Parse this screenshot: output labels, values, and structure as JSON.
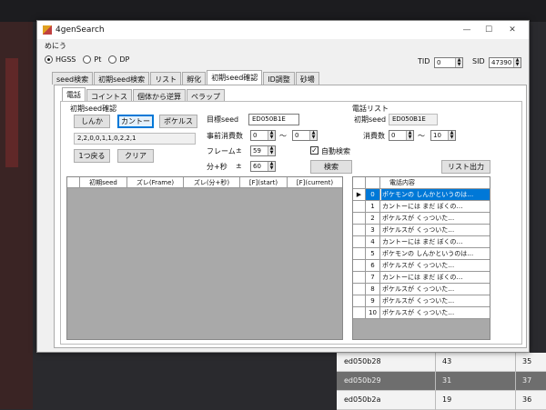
{
  "window": {
    "title": "4genSearch",
    "minimize": "—",
    "maximize": "☐",
    "close": "✕"
  },
  "menu": {
    "item": "めにう"
  },
  "versions": [
    {
      "label": "HGSS",
      "selected": true
    },
    {
      "label": "Pt",
      "selected": false
    },
    {
      "label": "DP",
      "selected": false
    }
  ],
  "tid": {
    "label": "TID",
    "value": "0"
  },
  "sid": {
    "label": "SID",
    "value": "47390"
  },
  "tabs": [
    "seed検索",
    "初期seed検索",
    "リスト",
    "孵化",
    "初期seed確認",
    "ID調整",
    "砂場"
  ],
  "subtabs": [
    "電話",
    "コイントス",
    "個体から逆算",
    "ペラップ"
  ],
  "left_group": {
    "title": "初期seed確認",
    "buttons": [
      "しんか",
      "カントー",
      "ポケルス"
    ],
    "sequence": "2,2,0,0,1,1,0,2,2,1",
    "back": "1つ戻る",
    "clear": "クリア"
  },
  "middle": {
    "target_seed_label": "目標seed",
    "target_seed_value": "ED050B1E",
    "pre_consume_label": "事前消費数",
    "pre_from": "0",
    "tilde": "〜",
    "pre_to": "0",
    "frame_label": "フレーム",
    "pm": "±",
    "frame_value": "59",
    "minsec_label": "分+秒",
    "minsec_value": "60",
    "auto_search": "自動検索",
    "search_button": "検索"
  },
  "left_grid": {
    "columns": [
      "初期seed",
      "ズレ(Frame)",
      "ズレ(分+秒)",
      "[F](start)",
      "[F](current)"
    ]
  },
  "right_group": {
    "title": "電話リスト",
    "seed_label": "初期seed",
    "seed_value": "ED050B1E",
    "consume_label": "消費数",
    "from": "0",
    "tilde": "〜",
    "to": "10",
    "export_button": "リスト出力",
    "column": "電話内容",
    "rows": [
      {
        "n": "0",
        "text": "ポケモンの しんかというのは…"
      },
      {
        "n": "1",
        "text": "カントーには まだ ぼくの…"
      },
      {
        "n": "2",
        "text": "ポケルスが くっついた…"
      },
      {
        "n": "3",
        "text": "ポケルスが くっついた…"
      },
      {
        "n": "4",
        "text": "カントーには まだ ぼくの…"
      },
      {
        "n": "5",
        "text": "ポケモンの しんかというのは…"
      },
      {
        "n": "6",
        "text": "ポケルスが くっついた…"
      },
      {
        "n": "7",
        "text": "カントーには まだ ぼくの…"
      },
      {
        "n": "8",
        "text": "ポケルスが くっついた…"
      },
      {
        "n": "9",
        "text": "ポケルスが くっついた…"
      },
      {
        "n": "10",
        "text": "ポケルスが くっついた…"
      }
    ]
  },
  "background_table": [
    {
      "c1": "ed050b28",
      "c2": "43",
      "c3": "35",
      "dark": false
    },
    {
      "c1": "ed050b29",
      "c2": "31",
      "c3": "37",
      "dark": true
    },
    {
      "c1": "ed050b2a",
      "c2": "19",
      "c3": "36",
      "dark": false
    }
  ]
}
